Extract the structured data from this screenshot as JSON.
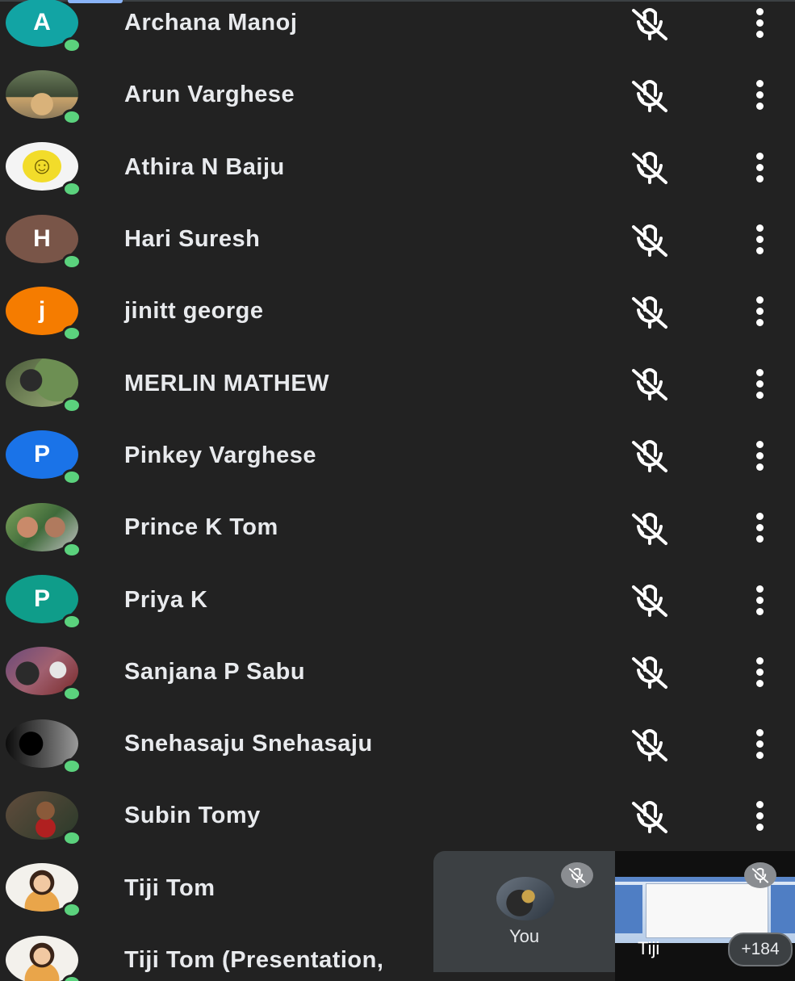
{
  "participants": [
    {
      "name": "Archana Manoj",
      "avatar_type": "letter",
      "letter": "A",
      "color": "#12a4a4"
    },
    {
      "name": "Arun Varghese",
      "avatar_type": "photo",
      "photo": "ph-arun"
    },
    {
      "name": "Athira N Baiju",
      "avatar_type": "emoji",
      "letter": "☺",
      "color": "#f4f4f4"
    },
    {
      "name": "Hari Suresh",
      "avatar_type": "letter",
      "letter": "H",
      "color": "#795548"
    },
    {
      "name": "jinitt george",
      "avatar_type": "letter",
      "letter": "j",
      "color": "#f57c00"
    },
    {
      "name": "MERLIN MATHEW",
      "avatar_type": "photo",
      "photo": "ph-merlin"
    },
    {
      "name": "Pinkey Varghese",
      "avatar_type": "letter",
      "letter": "P",
      "color": "#1a73e8"
    },
    {
      "name": "Prince K Tom",
      "avatar_type": "photo",
      "photo": "ph-prince"
    },
    {
      "name": "Priya K",
      "avatar_type": "letter",
      "letter": "P",
      "color": "#0f9d8a"
    },
    {
      "name": "Sanjana P Sabu",
      "avatar_type": "photo",
      "photo": "ph-sanjana"
    },
    {
      "name": "Snehasaju Snehasaju",
      "avatar_type": "photo",
      "photo": "ph-sneha"
    },
    {
      "name": "Subin Tomy",
      "avatar_type": "photo",
      "photo": "ph-subin"
    },
    {
      "name": "Tiji Tom",
      "avatar_type": "photo",
      "photo": "ph-tiji"
    },
    {
      "name": "Tiji Tom (Presentation,",
      "avatar_type": "photo",
      "photo": "ph-tiji"
    }
  ],
  "icons": {
    "mic": "mic-off-icon",
    "menu": "more-vert-icon"
  },
  "colors": {
    "background": "#222222",
    "presence": "#5bd27d",
    "text": "#e8eaed"
  },
  "tiles": {
    "you_label": "You",
    "presentation_label": "Tiji",
    "more_count": "+184"
  }
}
